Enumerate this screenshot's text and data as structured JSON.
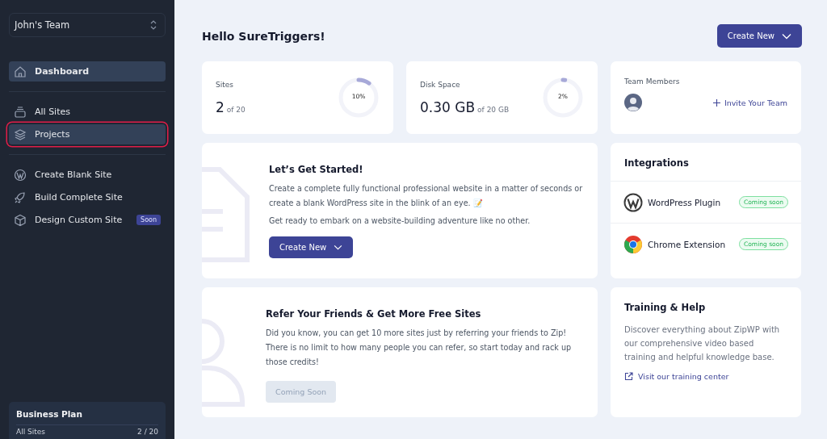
{
  "sidebar": {
    "team_selector": "John's Team",
    "groups": [
      [
        {
          "label": "Dashboard",
          "kind": "home",
          "selected": true,
          "highlighted": false
        }
      ],
      [
        {
          "label": "All Sites",
          "kind": "tray",
          "selected": false,
          "highlighted": false
        },
        {
          "label": "Projects",
          "kind": "layers",
          "selected": false,
          "highlighted": true
        }
      ],
      [
        {
          "label": "Create Blank Site",
          "kind": "wordpress",
          "selected": false,
          "highlighted": false
        },
        {
          "label": "Build Complete Site",
          "kind": "rocket",
          "selected": false,
          "highlighted": false
        },
        {
          "label": "Design Custom Site",
          "kind": "cube",
          "selected": false,
          "highlighted": false,
          "badge": "Soon"
        }
      ]
    ],
    "plan": {
      "title": "Business Plan",
      "row_label": "All Sites",
      "row_value": "2 / 20"
    }
  },
  "header": {
    "greeting": "Hello SureTriggers!",
    "button": "Create New"
  },
  "stats": [
    {
      "label": "Sites",
      "value": "2",
      "suffix": "of 20",
      "percent": "10%",
      "level": 0.1
    },
    {
      "label": "Disk Space",
      "value": "0.30 GB",
      "suffix": "of 20 GB",
      "percent": "2%",
      "level": 0.02
    }
  ],
  "team": {
    "label": "Team Members",
    "invite": "Invite Your Team"
  },
  "get_started": {
    "title": "Let’s Get Started!",
    "text": "Create a complete fully functional professional website in a matter of seconds or create a blank WordPress site in the blink of an eye. 📝",
    "text2": "Get ready to embark on a website-building adventure like no other.",
    "button": "Create New"
  },
  "refer": {
    "title": "Refer Your Friends & Get More Free Sites",
    "text": "Did you know, you can get 10 more sites just by referring your friends to Zip! There is no limit to how many people you can refer, so start today and rack up those credits!",
    "button": "Coming Soon",
    "disabled": true
  },
  "integrations": {
    "title": "Integrations",
    "items": [
      {
        "name": "WordPress Plugin",
        "kind": "wordpress",
        "badge": "Coming soon"
      },
      {
        "name": "Chrome Extension",
        "kind": "chrome",
        "badge": "Coming soon"
      }
    ]
  },
  "training": {
    "title": "Training & Help",
    "text": "Discover everything about ZipWP with our comprehensive video based training and helpful knowledge base.",
    "link": "Visit our training center"
  }
}
